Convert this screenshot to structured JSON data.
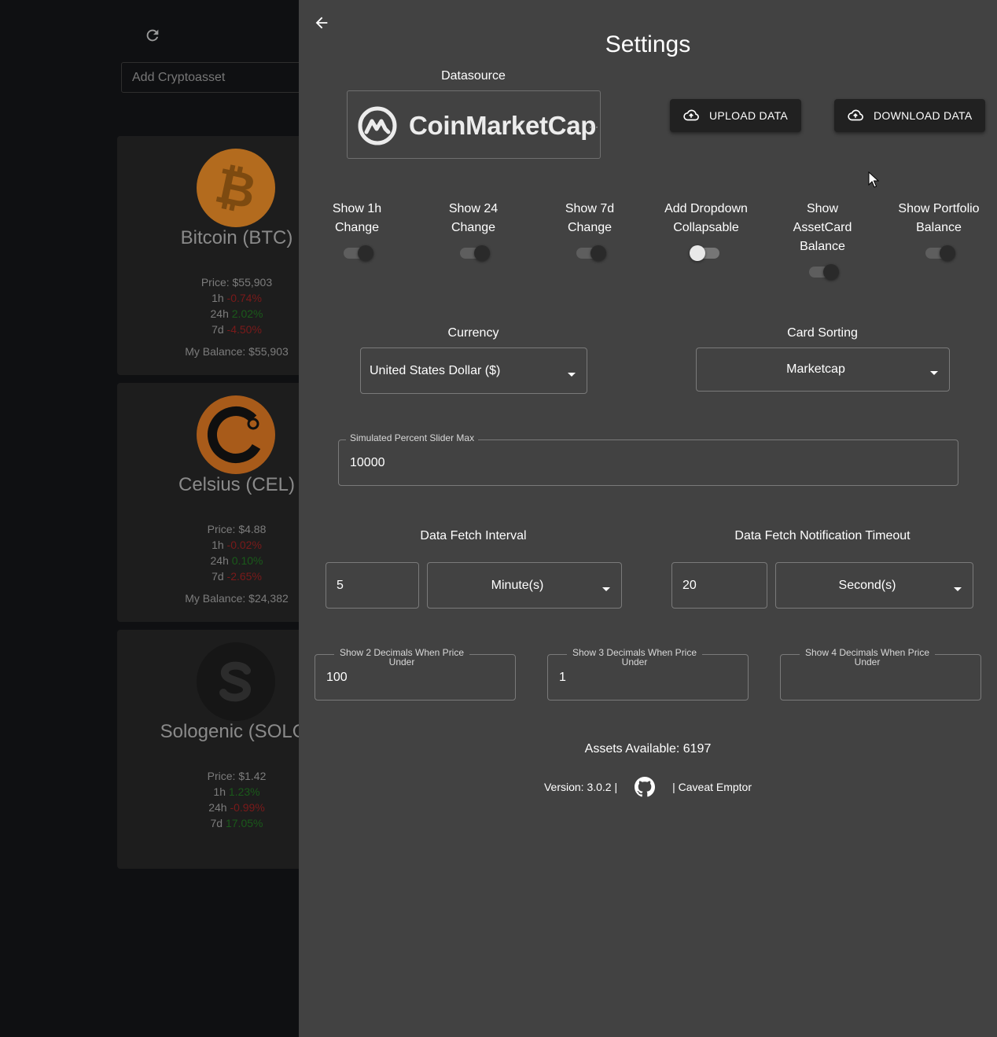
{
  "background": {
    "search_placeholder": "Add Cryptoasset",
    "cards": [
      {
        "name": "Bitcoin (BTC)",
        "price": "Price: $55,903",
        "ch1h_label": "1h",
        "ch1h": "-0.74%",
        "ch24h_label": "24h",
        "ch24h": "2.02%",
        "ch7d_label": "7d",
        "ch7d": "-4.50%",
        "balance": "My Balance: $55,903",
        "icon": "bitcoin-icon"
      },
      {
        "name": "Celsius (CEL)",
        "price": "Price: $4.88",
        "ch1h_label": "1h",
        "ch1h": "-0.02%",
        "ch24h_label": "24h",
        "ch24h": "0.10%",
        "ch7d_label": "7d",
        "ch7d": "-2.65%",
        "balance": "My Balance: $24,382",
        "icon": "celsius-icon"
      },
      {
        "name": "Sologenic (SOLO)",
        "price": "Price: $1.42",
        "ch1h_label": "1h",
        "ch1h": "1.23%",
        "ch24h_label": "24h",
        "ch24h": "-0.99%",
        "ch7d_label": "7d",
        "ch7d": "17.05%",
        "balance": "",
        "icon": "sologenic-icon"
      }
    ]
  },
  "settings": {
    "title": "Settings",
    "datasource_label": "Datasource",
    "datasource_name": "CoinMarketCap",
    "upload_label": "UPLOAD DATA",
    "download_label": "DOWNLOAD DATA",
    "toggles": [
      {
        "label": "Show 1h Change",
        "on": true
      },
      {
        "label": "Show 24 Change",
        "on": true
      },
      {
        "label": "Show 7d Change",
        "on": true
      },
      {
        "label": "Add Dropdown Collapsable",
        "on": false
      },
      {
        "label": "Show AssetCard Balance",
        "on": true
      },
      {
        "label": "Show Portfolio Balance",
        "on": true
      }
    ],
    "currency_label": "Currency",
    "currency_value": "United States Dollar ($)",
    "sorting_label": "Card Sorting",
    "sorting_value": "Marketcap",
    "slider_max_label": "Simulated Percent Slider Max",
    "slider_max_value": "10000",
    "fetch_interval_label": "Data Fetch Interval",
    "fetch_interval_value": "5",
    "fetch_interval_unit": "Minute(s)",
    "notif_timeout_label": "Data Fetch Notification Timeout",
    "notif_timeout_value": "20",
    "notif_timeout_unit": "Second(s)",
    "decimals": [
      {
        "label": "Show 2 Decimals When Price Under",
        "value": "100"
      },
      {
        "label": "Show 3 Decimals When Price Under",
        "value": "1"
      },
      {
        "label": "Show 4 Decimals When Price Under",
        "value": ""
      }
    ],
    "assets_available": "Assets Available: 6197",
    "version": "Version: 3.0.2 |",
    "caveat": "| Caveat Emptor"
  },
  "colors": {
    "drawer_bg": "#424242",
    "negative": "#d32f2f",
    "positive": "#2e7d32"
  }
}
